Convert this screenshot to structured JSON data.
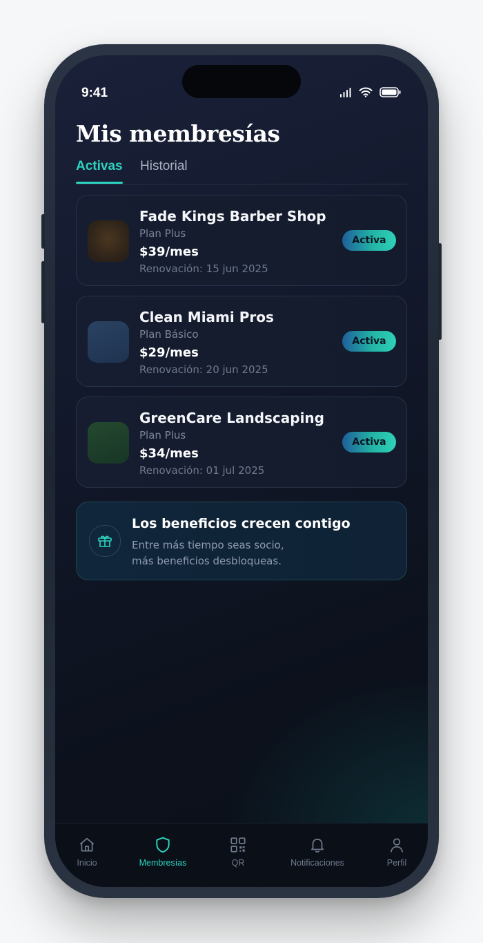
{
  "status_bar": {
    "time": "9:41"
  },
  "page": {
    "title": "Mis membresías"
  },
  "tabs": [
    {
      "label": "Activas",
      "active": true
    },
    {
      "label": "Historial",
      "active": false
    }
  ],
  "memberships": [
    {
      "name": "Fade Kings Barber Shop",
      "plan": "Plan Plus",
      "price": "$39/mes",
      "renewal": "Renovación: 15 jun 2025",
      "status": "Activa",
      "thumb_color": "#3a2d1c"
    },
    {
      "name": "Clean Miami Pros",
      "plan": "Plan Básico",
      "price": "$29/mes",
      "renewal": "Renovación: 20 jun 2025",
      "status": "Activa",
      "thumb_color": "#243a55"
    },
    {
      "name": "GreenCare Landscaping",
      "plan": "Plan Plus",
      "price": "$34/mes",
      "renewal": "Renovación: 01 jul 2025",
      "status": "Activa",
      "thumb_color": "#1e3f2c"
    }
  ],
  "benefit": {
    "title": "Los beneficios crecen contigo",
    "line1": "Entre más tiempo seas socio,",
    "line2": "más beneficios desbloqueas.",
    "icon": "gift-icon"
  },
  "nav": [
    {
      "label": "Inicio",
      "icon": "home-icon",
      "active": false
    },
    {
      "label": "Membresías",
      "icon": "shield-icon",
      "active": true
    },
    {
      "label": "QR",
      "icon": "qr-icon",
      "active": false
    },
    {
      "label": "Notificaciones",
      "icon": "bell-icon",
      "active": false
    },
    {
      "label": "Perfil",
      "icon": "user-icon",
      "active": false
    }
  ],
  "colors": {
    "accent": "#2dd4bf",
    "background": "#0c111c",
    "card": "#161d30"
  }
}
